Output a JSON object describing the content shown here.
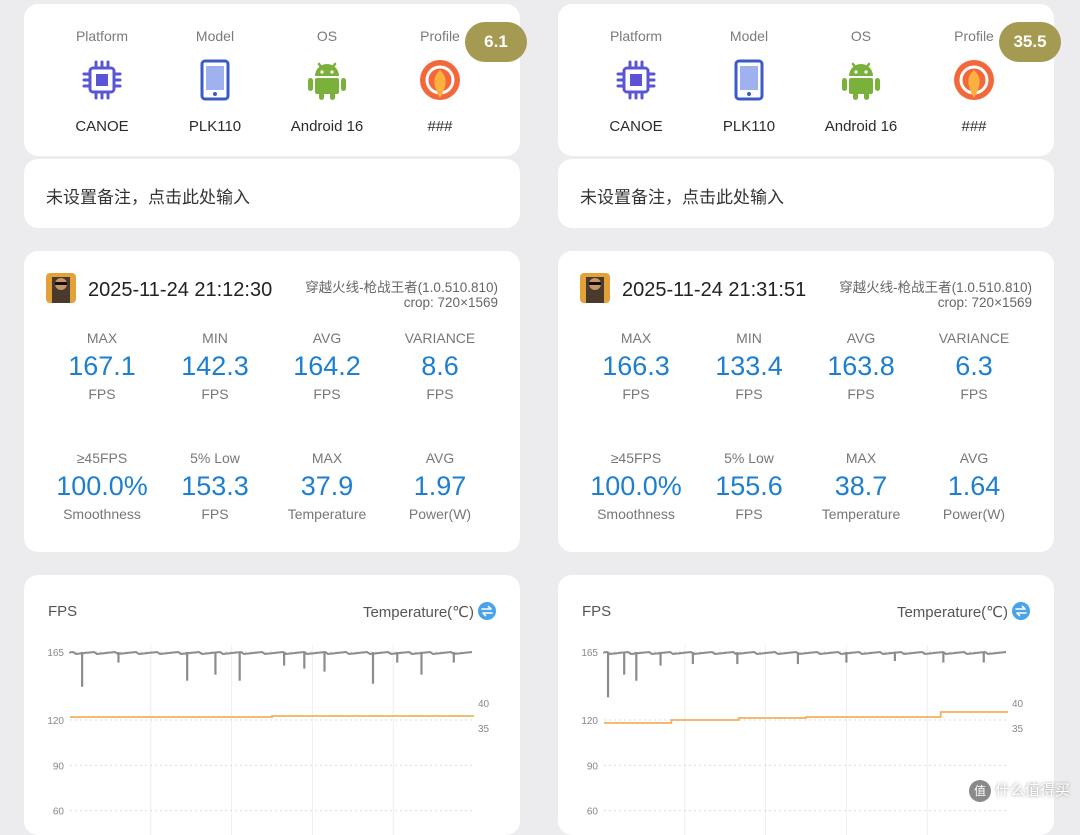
{
  "device_headers": {
    "platform": "Platform",
    "model": "Model",
    "os": "OS",
    "profile": "Profile"
  },
  "icons": {
    "platform": "chip-icon",
    "model": "phone-icon",
    "os": "android-icon",
    "profile": "profile-icon",
    "switch": "swap-icon"
  },
  "colors": {
    "accent_blue": "#1e7fd0",
    "badge": "#a59a52",
    "temp_line": "#f2b05c",
    "fps_line": "#8c8c8c"
  },
  "sessions": [
    {
      "device": {
        "platform": "CANOE",
        "model": "PLK110",
        "os": "Android 16",
        "profile": "###",
        "badge": "6.1"
      },
      "note": "未设置备注，点击此处输入",
      "session_time": "2025-11-24 21:12:30",
      "game": "穿越火线-枪战王者(1.0.510.810)",
      "crop": "crop: 720×1569",
      "metrics": [
        {
          "label": "MAX",
          "value": "167.1",
          "unit": "FPS"
        },
        {
          "label": "MIN",
          "value": "142.3",
          "unit": "FPS"
        },
        {
          "label": "AVG",
          "value": "164.2",
          "unit": "FPS"
        },
        {
          "label": "VARIANCE",
          "value": "8.6",
          "unit": "FPS"
        },
        {
          "label": "≥45FPS",
          "value": "100.0%",
          "unit": "Smoothness"
        },
        {
          "label": "5% Low",
          "value": "153.3",
          "unit": "FPS"
        },
        {
          "label": "MAX",
          "value": "37.9",
          "unit": "Temperature"
        },
        {
          "label": "AVG",
          "value": "1.97",
          "unit": "Power(W)"
        }
      ],
      "graph": {
        "title_left": "FPS",
        "title_right": "Temperature(℃)",
        "fps_ticks": [
          "165",
          "120",
          "90",
          "60"
        ],
        "temp_ticks": [
          "40",
          "35"
        ],
        "temp_levels": [
          37.2,
          37.2,
          37.2,
          37.4,
          37.4,
          37.4
        ],
        "fps_dips": [
          {
            "t": 0.03,
            "fps": 142
          },
          {
            "t": 0.12,
            "fps": 158
          },
          {
            "t": 0.29,
            "fps": 146
          },
          {
            "t": 0.36,
            "fps": 150
          },
          {
            "t": 0.42,
            "fps": 146
          },
          {
            "t": 0.53,
            "fps": 156
          },
          {
            "t": 0.58,
            "fps": 154
          },
          {
            "t": 0.63,
            "fps": 152
          },
          {
            "t": 0.75,
            "fps": 144
          },
          {
            "t": 0.81,
            "fps": 158
          },
          {
            "t": 0.87,
            "fps": 150
          },
          {
            "t": 0.95,
            "fps": 158
          }
        ]
      }
    },
    {
      "device": {
        "platform": "CANOE",
        "model": "PLK110",
        "os": "Android 16",
        "profile": "###",
        "badge": "35.5"
      },
      "note": "未设置备注，点击此处输入",
      "session_time": "2025-11-24 21:31:51",
      "game": "穿越火线-枪战王者(1.0.510.810)",
      "crop": "crop: 720×1569",
      "metrics": [
        {
          "label": "MAX",
          "value": "166.3",
          "unit": "FPS"
        },
        {
          "label": "MIN",
          "value": "133.4",
          "unit": "FPS"
        },
        {
          "label": "AVG",
          "value": "163.8",
          "unit": "FPS"
        },
        {
          "label": "VARIANCE",
          "value": "6.3",
          "unit": "FPS"
        },
        {
          "label": "≥45FPS",
          "value": "100.0%",
          "unit": "Smoothness"
        },
        {
          "label": "5% Low",
          "value": "155.6",
          "unit": "FPS"
        },
        {
          "label": "MAX",
          "value": "38.7",
          "unit": "Temperature"
        },
        {
          "label": "AVG",
          "value": "1.64",
          "unit": "Power(W)"
        }
      ],
      "graph": {
        "title_left": "FPS",
        "title_right": "Temperature(℃)",
        "fps_ticks": [
          "165",
          "120",
          "90",
          "60"
        ],
        "temp_ticks": [
          "40",
          "35"
        ],
        "temp_levels": [
          36.0,
          36.6,
          37.0,
          37.2,
          37.2,
          38.2
        ],
        "fps_dips": [
          {
            "t": 0.01,
            "fps": 135
          },
          {
            "t": 0.05,
            "fps": 150
          },
          {
            "t": 0.08,
            "fps": 146
          },
          {
            "t": 0.14,
            "fps": 156
          },
          {
            "t": 0.22,
            "fps": 157
          },
          {
            "t": 0.33,
            "fps": 157
          },
          {
            "t": 0.48,
            "fps": 157
          },
          {
            "t": 0.6,
            "fps": 158
          },
          {
            "t": 0.72,
            "fps": 159
          },
          {
            "t": 0.84,
            "fps": 158
          },
          {
            "t": 0.94,
            "fps": 158
          }
        ]
      }
    }
  ],
  "watermark": "什么值得买"
}
